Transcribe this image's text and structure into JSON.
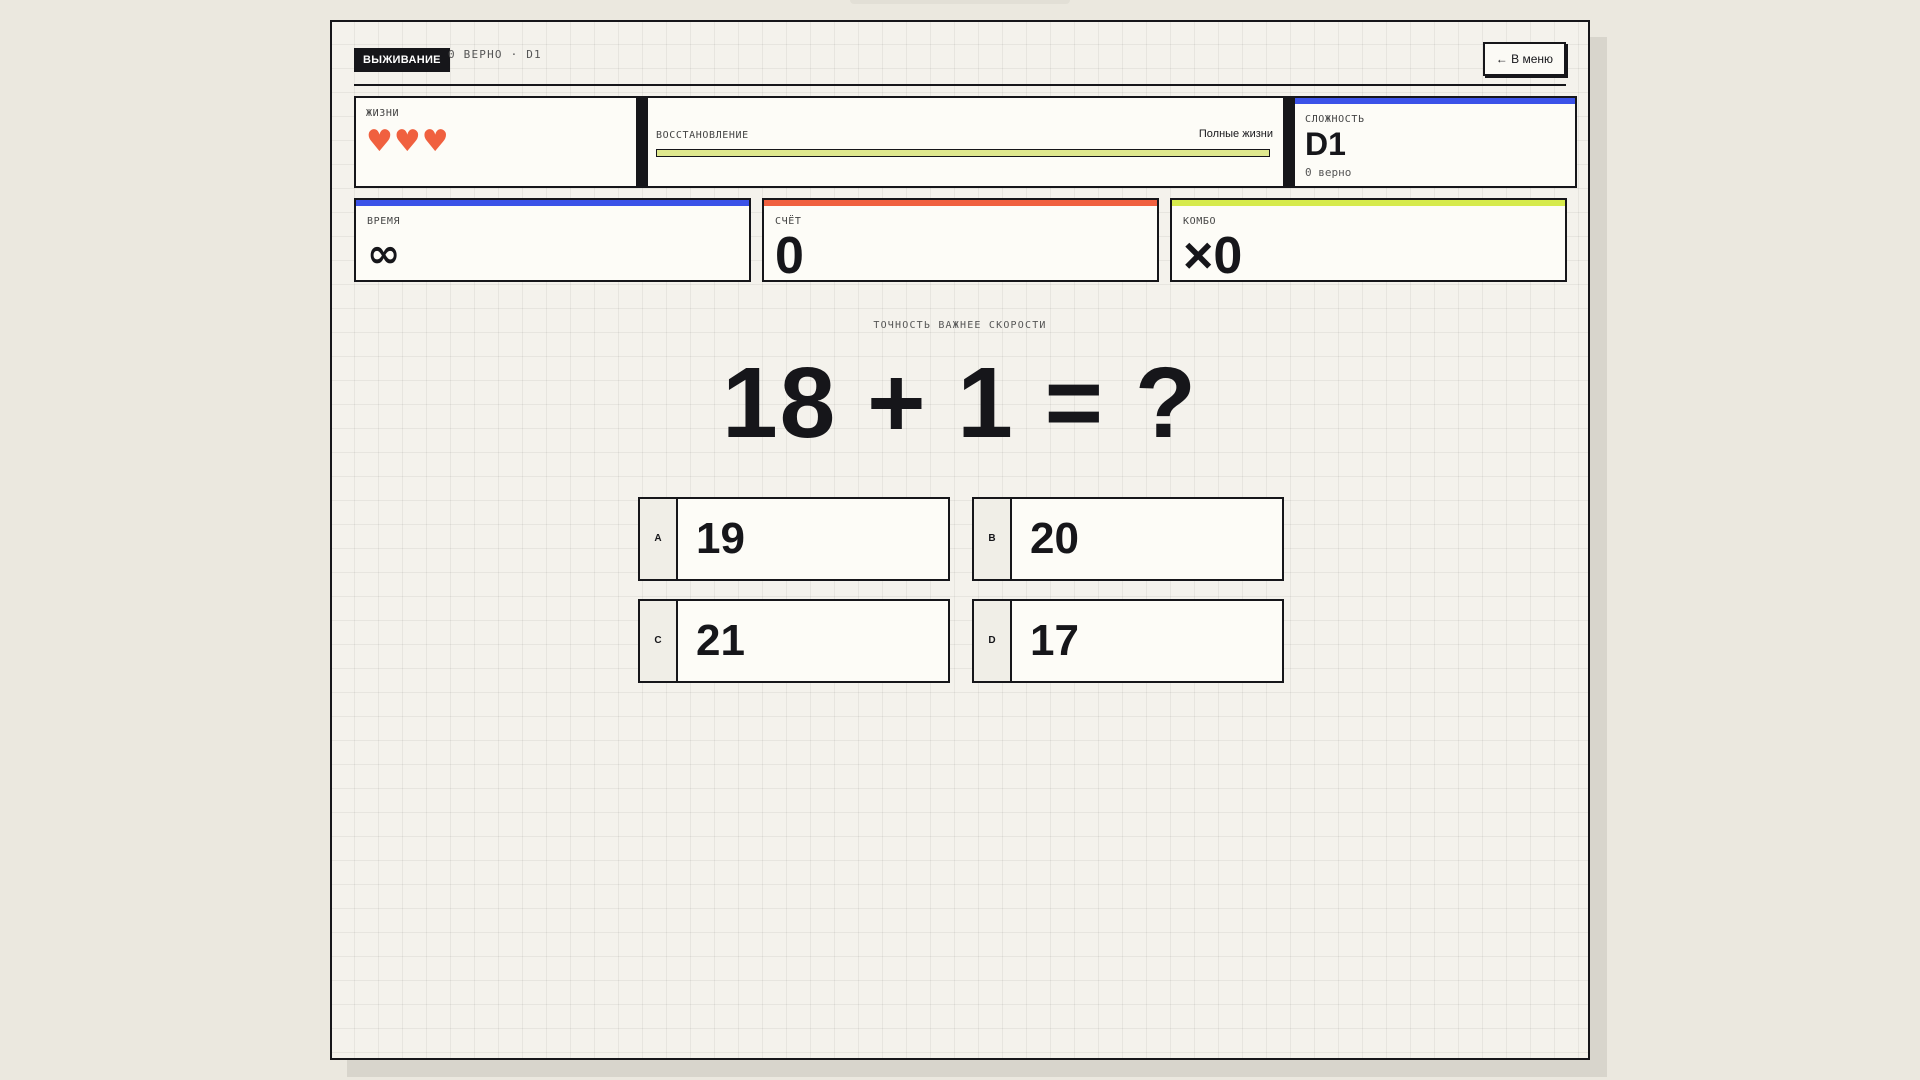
{
  "header": {
    "mode_label": "ВЫЖИВАНИЕ",
    "subtitle": "0 ВЕРНО · D1",
    "menu_button": "← В меню"
  },
  "lives": {
    "label": "ЖИЗНИ",
    "hearts": "♥♥♥",
    "count": 3
  },
  "regen": {
    "label": "ВОССТАНОВЛЕНИЕ",
    "state": "Полные жизни",
    "progress": 1.0
  },
  "difficulty": {
    "label": "СЛОЖНОСТЬ",
    "value": "D1",
    "sub": "0 верно"
  },
  "stats": {
    "time": {
      "label": "ВРЕМЯ",
      "value": "∞"
    },
    "score": {
      "label": "СЧЁТ",
      "value": "0"
    },
    "combo": {
      "label": "КОМБО",
      "value": "×0"
    }
  },
  "question": {
    "hint": "ТОЧНОСТЬ ВАЖНЕЕ СКОРОСТИ",
    "text": "18 + 1 = ?"
  },
  "answers": [
    {
      "key": "A",
      "value": "19"
    },
    {
      "key": "B",
      "value": "20"
    },
    {
      "key": "C",
      "value": "21"
    },
    {
      "key": "D",
      "value": "17"
    }
  ],
  "colors": {
    "blue": "#3b52e8",
    "red": "#f0603f",
    "lime": "#d6ea4c",
    "ink": "#16161a"
  }
}
